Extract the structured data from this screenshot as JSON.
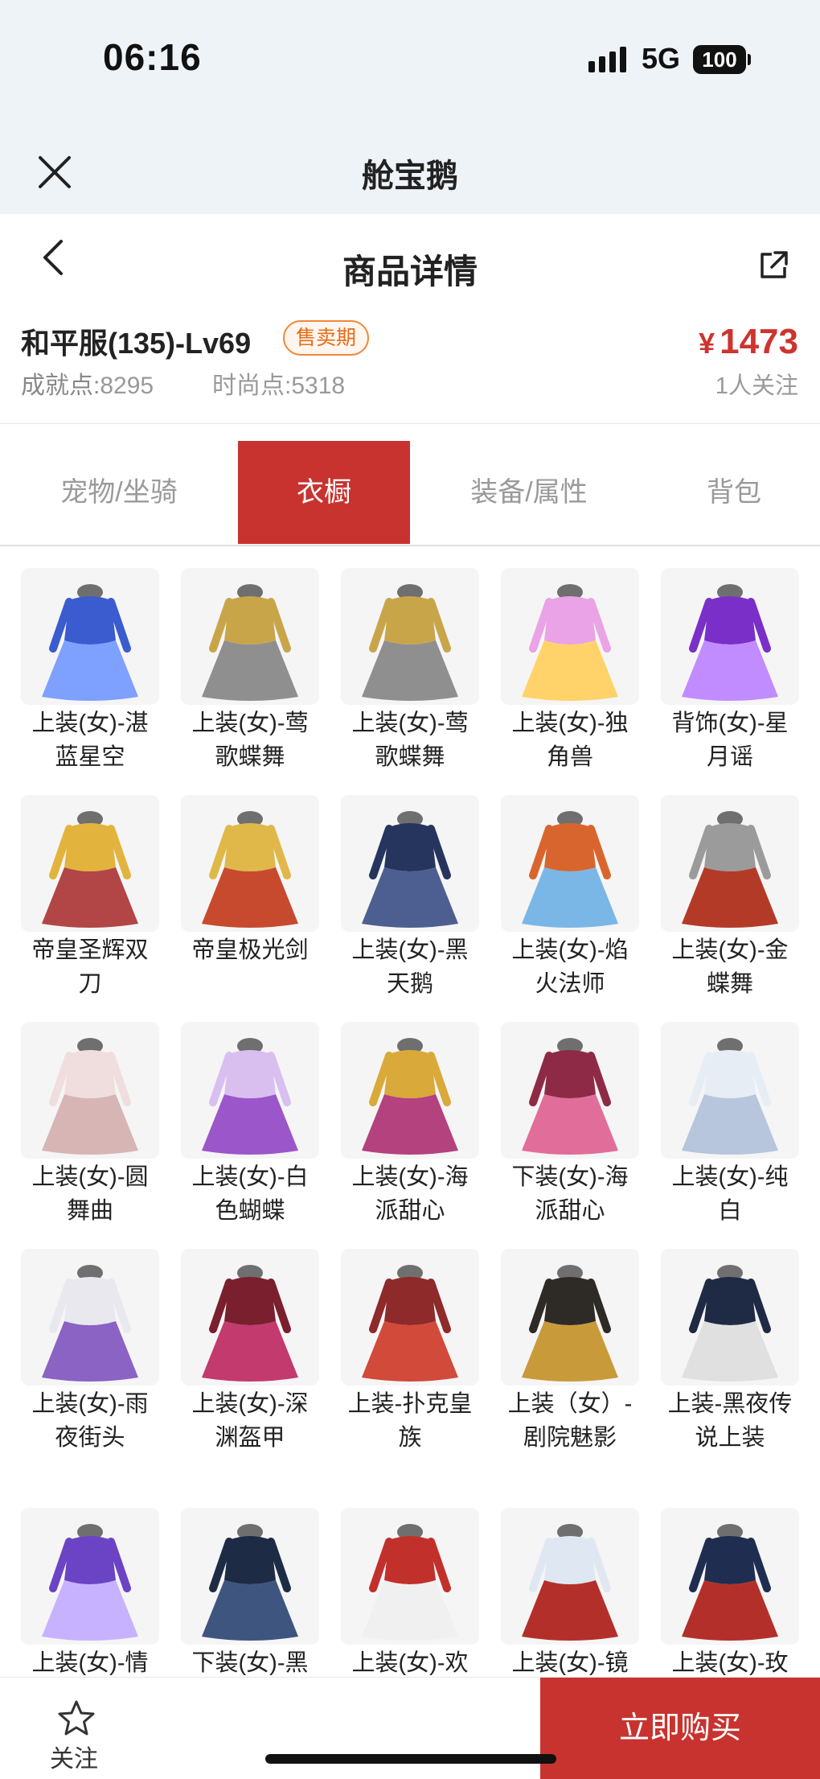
{
  "status_bar": {
    "time": "06:16",
    "network": "5G",
    "battery": "100"
  },
  "app": {
    "title": "舱宝鹅"
  },
  "nav": {
    "title": "商品详情"
  },
  "product": {
    "name": "和平服(135)-Lv69",
    "badge": "售卖期",
    "achievement_label": "成就点:",
    "achievement_value": "8295",
    "fashion_label": "时尚点:",
    "fashion_value": "5318",
    "currency": "¥",
    "price": "1473",
    "followers": "1人关注"
  },
  "tabs": [
    {
      "label": "宠物/坐骑",
      "active": false
    },
    {
      "label": "衣橱",
      "active": true
    },
    {
      "label": "装备/属性",
      "active": false
    },
    {
      "label": "背包",
      "active": false
    }
  ],
  "items": [
    {
      "label": "上装(女)-湛蓝星空",
      "icon": "blue-dress-icon"
    },
    {
      "label": "上装(女)-莺歌蝶舞",
      "icon": "gold-winged-outfit-icon"
    },
    {
      "label": "上装(女)-莺歌蝶舞",
      "icon": "gold-winged-outfit-icon"
    },
    {
      "label": "上装(女)-独角兽",
      "icon": "rainbow-wings-icon"
    },
    {
      "label": "背饰(女)-星月谣",
      "icon": "purple-wings-icon"
    },
    {
      "label": "帝皇圣辉双刀",
      "icon": "twin-blades-icon"
    },
    {
      "label": "帝皇极光剑",
      "icon": "golden-sword-icon"
    },
    {
      "label": "上装(女)-黑天鹅",
      "icon": "dark-blue-gown-icon"
    },
    {
      "label": "上装(女)-焰火法师",
      "icon": "flame-mage-outfit-icon"
    },
    {
      "label": "上装(女)-金蝶舞",
      "icon": "red-grey-outfit-icon"
    },
    {
      "label": "上装(女)-圆舞曲",
      "icon": "white-pink-dress-icon"
    },
    {
      "label": "上装(女)-白色蝴蝶",
      "icon": "lilac-gown-icon"
    },
    {
      "label": "上装(女)-海派甜心",
      "icon": "golden-top-icon"
    },
    {
      "label": "下装(女)-海派甜心",
      "icon": "pink-skirt-icon"
    },
    {
      "label": "上装(女)-纯白",
      "icon": "white-gown-icon"
    },
    {
      "label": "上装(女)-雨夜街头",
      "icon": "white-purple-coat-icon"
    },
    {
      "label": "上装(女)-深渊盔甲",
      "icon": "crimson-armor-icon"
    },
    {
      "label": "上装-扑克皇族",
      "icon": "red-poker-coat-icon"
    },
    {
      "label": "上装（女）-剧院魅影",
      "icon": "black-gold-dress-icon"
    },
    {
      "label": "上装-黑夜传说上装",
      "icon": "navy-coat-icon"
    },
    {
      "label": "上装(女)-情",
      "icon": "purple-ball-gown-icon"
    },
    {
      "label": "下装(女)-黑",
      "icon": "navy-heels-icon"
    },
    {
      "label": "上装(女)-欢",
      "icon": "red-dress-icon"
    },
    {
      "label": "上装(女)-镜",
      "icon": "white-red-robe-icon"
    },
    {
      "label": "上装(女)-玫",
      "icon": "navy-red-coat-icon"
    }
  ],
  "bottom_bar": {
    "follow_label": "关注",
    "buy_label": "立即购买"
  },
  "colors": {
    "accent": "#c8332f",
    "badge": "#ea6a15",
    "price": "#cd3430"
  }
}
